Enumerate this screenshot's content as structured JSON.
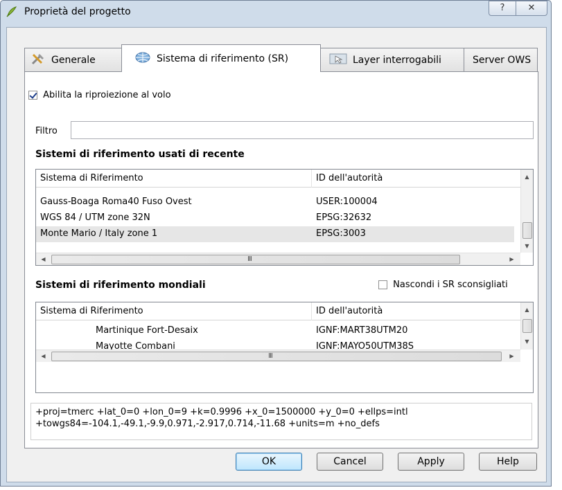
{
  "window": {
    "title": "Proprietà del progetto",
    "help_glyph": "?",
    "close_glyph": "✕"
  },
  "tabs": [
    {
      "label": "Generale",
      "icon": "tools-icon"
    },
    {
      "label": "Sistema di riferimento (SR)",
      "icon": "globe-icon"
    },
    {
      "label": "Layer interrogabili",
      "icon": "identify-layer-icon"
    },
    {
      "label": "Server OWS"
    }
  ],
  "reprojection": {
    "label": "Abilita la riproiezione al volo",
    "checked": true
  },
  "filter": {
    "label": "Filtro",
    "value": ""
  },
  "recent": {
    "title": "Sistemi di riferimento usati di recente",
    "columns": [
      "Sistema di Riferimento",
      "ID dell'autorità"
    ],
    "rows": [
      {
        "name": "Gauss-Boaga Roma40 Fuso Ovest",
        "id": "USER:100004"
      },
      {
        "name": "WGS 84 / UTM zone 32N",
        "id": "EPSG:32632"
      },
      {
        "name": "Monte Mario / Italy zone 1",
        "id": "EPSG:3003",
        "selected": true
      }
    ]
  },
  "world": {
    "title": "Sistemi di riferimento mondiali",
    "hide_deprecated_label": "Nascondi i SR sconsigliati",
    "hide_deprecated_checked": false,
    "columns": [
      "Sistema di Riferimento",
      "ID dell'autorità"
    ],
    "rows": [
      {
        "name": "Martinique Fort-Desaix",
        "id": "IGNF:MART38UTM20"
      },
      {
        "name": "Mayotte Combani",
        "id": "IGNF:MAYO50UTM38S"
      }
    ]
  },
  "proj_string": {
    "line1": "+proj=tmerc +lat_0=0 +lon_0=9 +k=0.9996 +x_0=1500000 +y_0=0 +ellps=intl",
    "line2": "+towgs84=-104.1,-49.1,-9.9,0.971,-2.917,0.714,-11.68 +units=m +no_defs"
  },
  "scroll_grip": "III",
  "buttons": {
    "ok": "OK",
    "cancel": "Cancel",
    "apply": "Apply",
    "help": "Help"
  }
}
